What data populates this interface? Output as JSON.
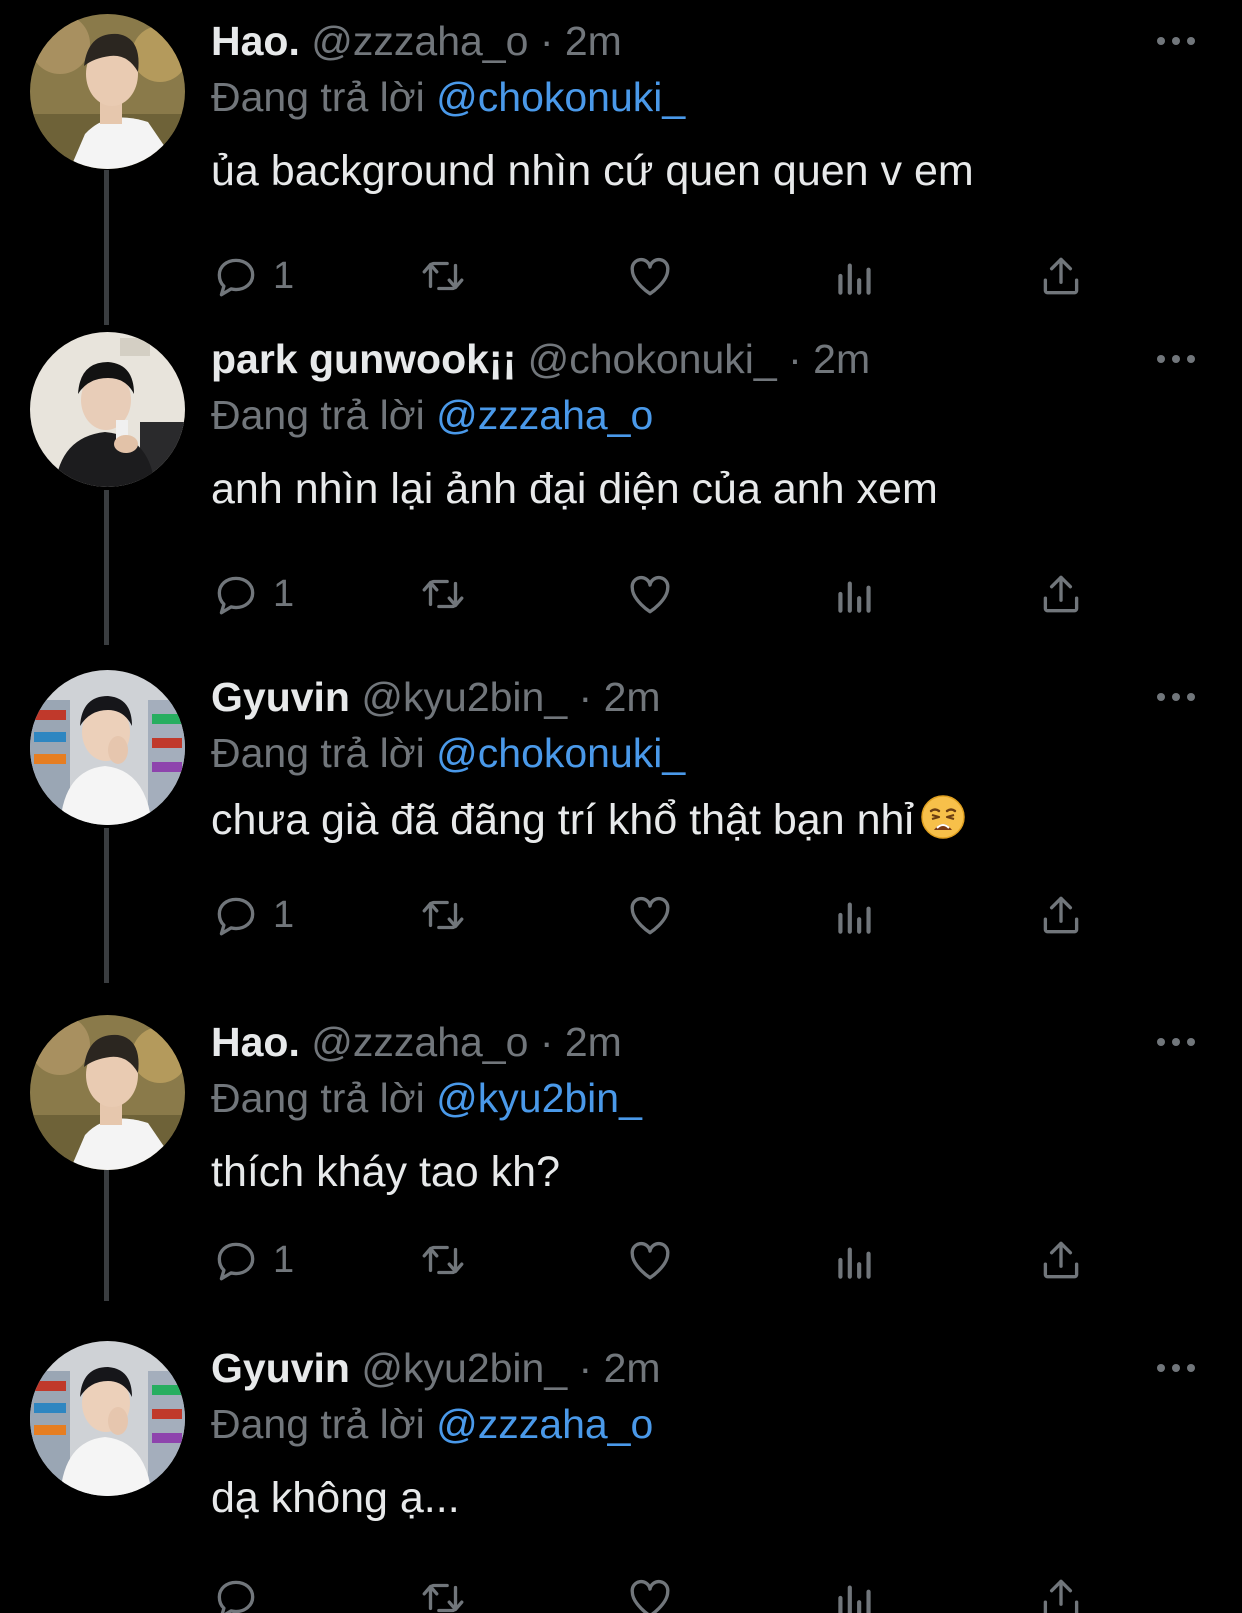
{
  "replying_label": "Đang trả lời",
  "tweets": [
    {
      "display_name": "Hao.",
      "handle": "@zzzaha_o",
      "separator": "·",
      "time": "2m",
      "replying_to": "@chokonuki_",
      "text": "ủa background nhìn cứ quen quen v em",
      "reply_count": "1",
      "avatar": "avatar-hao"
    },
    {
      "display_name": "park gunwook¡¡",
      "handle": "@chokonuki_",
      "separator": "·",
      "time": "2m",
      "replying_to": "@zzzaha_o",
      "text": "anh nhìn lại ảnh đại diện của anh xem",
      "reply_count": "1",
      "avatar": "avatar-gunwook"
    },
    {
      "display_name": "Gyuvin",
      "handle": "@kyu2bin_",
      "separator": "·",
      "time": "2m",
      "replying_to": "@chokonuki_",
      "text": "chưa già đã đãng trí khổ thật bạn nhỉ",
      "emoji": "weary-face-emoji",
      "reply_count": "1",
      "avatar": "avatar-gyuvin"
    },
    {
      "display_name": "Hao.",
      "handle": "@zzzaha_o",
      "separator": "·",
      "time": "2m",
      "replying_to": "@kyu2bin_",
      "text": "thích kháy tao kh?",
      "reply_count": "1",
      "avatar": "avatar-hao"
    },
    {
      "display_name": "Gyuvin",
      "handle": "@kyu2bin_",
      "separator": "·",
      "time": "2m",
      "replying_to": "@zzzaha_o",
      "text": "dạ không ạ...",
      "reply_count": "",
      "avatar": "avatar-gyuvin"
    }
  ],
  "icons": {
    "reply": "reply-icon",
    "retweet": "retweet-icon",
    "like": "heart-icon",
    "views": "views-icon",
    "share": "share-icon",
    "more": "more-icon"
  },
  "colors": {
    "background": "#000000",
    "text": "#e7e9ea",
    "secondary": "#71767b",
    "mention": "#4a99e9",
    "thread_line": "#3a3d40"
  }
}
